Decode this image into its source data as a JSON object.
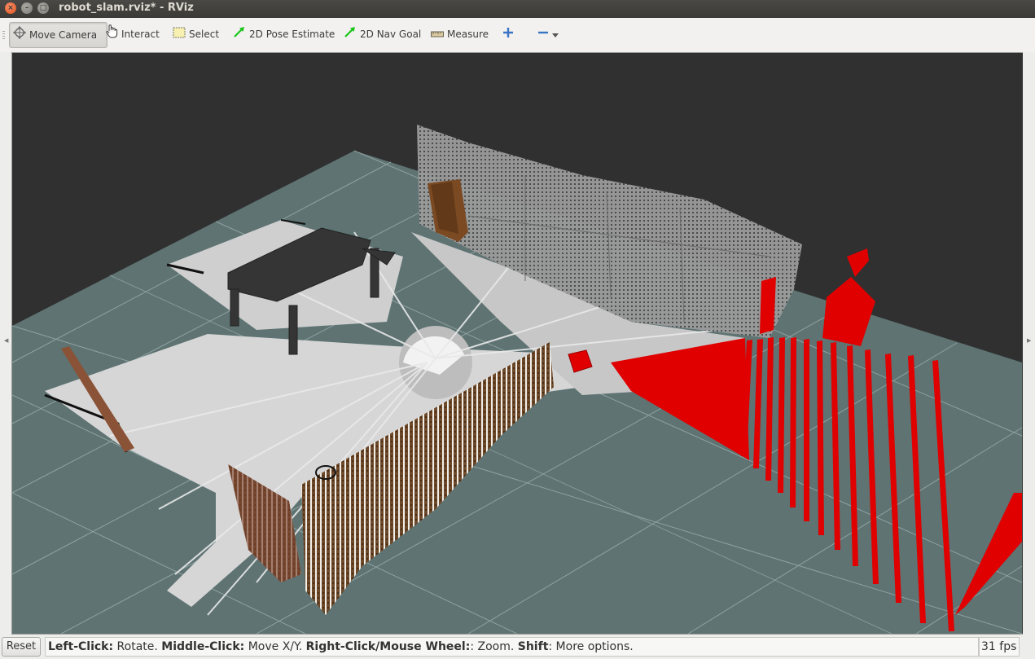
{
  "window": {
    "title": "robot_slam.rviz* - RViz",
    "close_glyph": "×",
    "min_glyph": "–",
    "max_glyph": "□"
  },
  "toolbar": {
    "move_camera": "Move Camera",
    "interact": "Interact",
    "select": "Select",
    "pose_estimate": "2D Pose Estimate",
    "nav_goal": "2D Nav Goal",
    "measure": "Measure",
    "add_tool_icon": "plus-icon",
    "remove_tool_icon": "minus-icon"
  },
  "colors": {
    "laser_scan": "#e00000",
    "grid_floor": "#5e7372",
    "grid_lines": "#8ea2a1",
    "background": "#303030",
    "free_space": "#d6d6d6",
    "pose_arrow": "#19c519"
  },
  "status": {
    "reset": "Reset",
    "hint_left_click_key": "Left-Click:",
    "hint_left_click_val": " Rotate. ",
    "hint_middle_click_key": "Middle-Click:",
    "hint_middle_click_val": " Move X/Y. ",
    "hint_right_click_key": "Right-Click/Mouse Wheel:",
    "hint_right_click_val": ": Zoom. ",
    "hint_shift_key": "Shift",
    "hint_shift_val": ": More options.",
    "fps": "31 fps"
  }
}
